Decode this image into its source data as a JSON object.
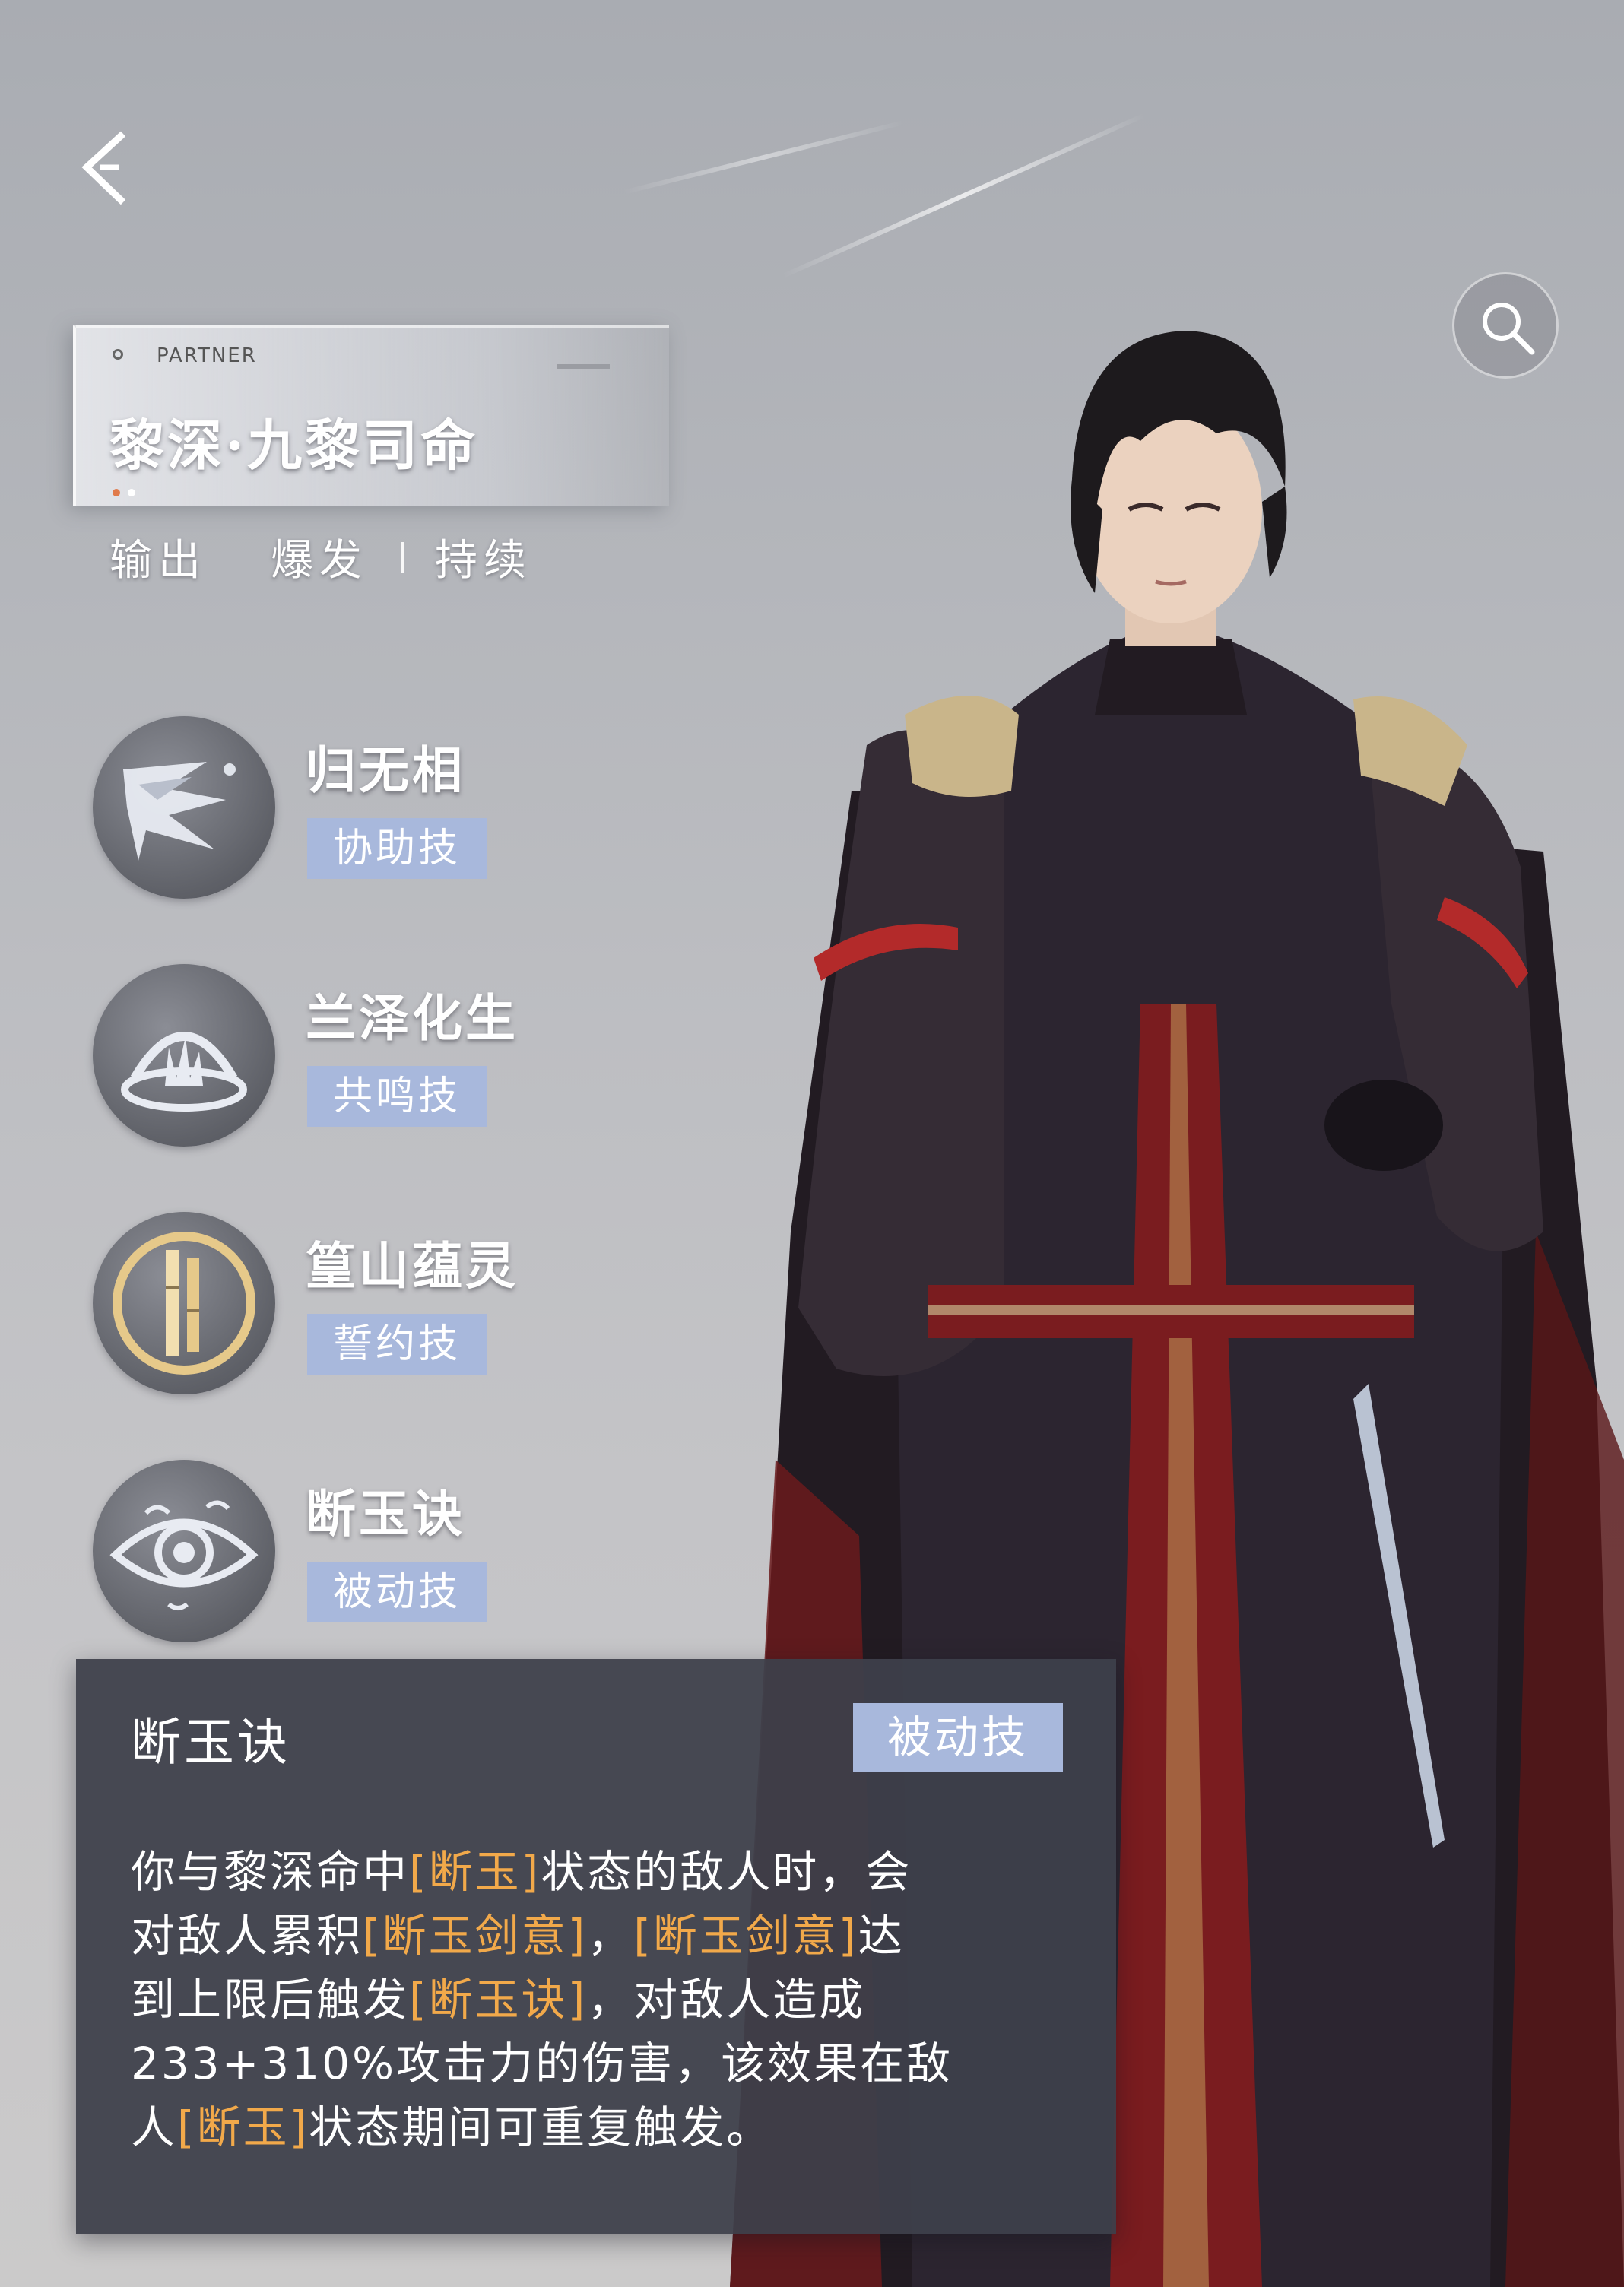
{
  "header": {
    "back_icon": "chevron-left-icon",
    "search_icon": "magnifier-icon"
  },
  "namecard": {
    "partner_label": "PARTNER",
    "character_name": "黎深·九黎司命",
    "pips": [
      "#e07a4a",
      "#ffffff"
    ]
  },
  "tags": [
    "输出",
    "爆发",
    "持续"
  ],
  "skills": [
    {
      "name": "归无相",
      "type": "协助技",
      "icon": "shard-burst-icon"
    },
    {
      "name": "兰泽化生",
      "type": "共鸣技",
      "icon": "grass-ring-icon"
    },
    {
      "name": "篁山蕴灵",
      "type": "誓约技",
      "icon": "bamboo-gold-icon"
    },
    {
      "name": "断玉诀",
      "type": "被动技",
      "icon": "eye-icon"
    }
  ],
  "detail": {
    "title": "断玉诀",
    "type": "被动技",
    "lines": [
      [
        {
          "t": "你与黎深命中"
        },
        {
          "t": "[断玉]",
          "hl": true
        },
        {
          "t": "状态的敌人时，会"
        }
      ],
      [
        {
          "t": "对敌人累积"
        },
        {
          "t": "[断玉剑意]",
          "hl": true
        },
        {
          "t": "，"
        },
        {
          "t": "[断玉剑意]",
          "hl": true
        },
        {
          "t": "达"
        }
      ],
      [
        {
          "t": "到上限后触发"
        },
        {
          "t": "[断玉诀]",
          "hl": true
        },
        {
          "t": "，对敌人造成"
        }
      ],
      [
        {
          "t": "233+310%攻击力的伤害，该效果在敌"
        }
      ],
      [
        {
          "t": "人"
        },
        {
          "t": "[断玉]",
          "hl": true
        },
        {
          "t": "状态期间可重复触发。"
        }
      ]
    ]
  },
  "colors": {
    "badge": "#a8b8dc",
    "highlight": "#f2a94a",
    "panel": "#3e404a"
  }
}
